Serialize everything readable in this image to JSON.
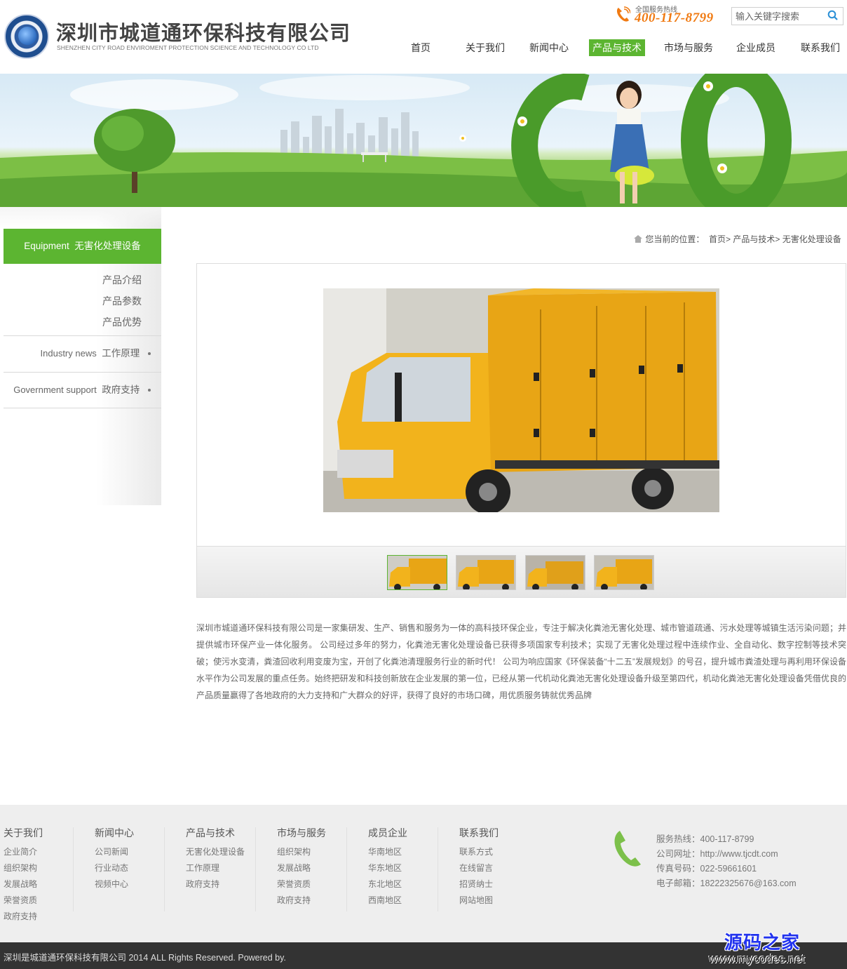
{
  "header": {
    "company_name": "深圳市城道通环保科技有限公司",
    "company_name_en": "SHENZHEN CITY ROAD ENVIROMENT PROTECTION SCIENCE AND TECHNOLOGY CO LTD",
    "hotline_label": "全国服务热线",
    "hotline_number": "400-117-8799",
    "search_placeholder": "输入关键字搜索",
    "accent_color": "#5cb531",
    "hotline_color": "#f07a12"
  },
  "nav": {
    "items": [
      {
        "label": "首页"
      },
      {
        "label": "关于我们"
      },
      {
        "label": "新闻中心"
      },
      {
        "label": "产品与技术",
        "active": true
      },
      {
        "label": "市场与服务"
      },
      {
        "label": "企业成员"
      },
      {
        "label": "联系我们"
      }
    ]
  },
  "sidebar": {
    "header_en": "Equipment",
    "header_cn": "无害化处理设备",
    "sub_items": [
      "产品介绍",
      "产品参数",
      "产品优势"
    ],
    "categories": [
      {
        "en": "Industry news",
        "cn": "工作原理"
      },
      {
        "en": "Government support",
        "cn": "政府支持"
      }
    ]
  },
  "breadcrumb": {
    "prefix": "您当前的位置：",
    "items": [
      "首页",
      "产品与技术",
      "无害化处理设备"
    ],
    "separator": ">"
  },
  "gallery": {
    "thumbnail_count": 4,
    "active_thumbnail": 1
  },
  "description": "深圳市城道通环保科技有限公司是一家集研发、生产、销售和服务为一体的高科技环保企业，专注于解决化粪池无害化处理、城市管道疏通、污水处理等城镇生活污染问题；并提供城市环保产业一体化服务。 公司经过多年的努力，化粪池无害化处理设备已获得多项国家专利技术；实现了无害化处理过程中连续作业、全自动化、数字控制等技术突破；使污水变清，粪渣回收利用变废为宝，开创了化粪池清理服务行业的新时代！ 公司为响应国家《环保装备“十二五”发展规划》的号召，提升城市粪渣处理与再利用环保设备水平作为公司发展的重点任务。始终把研发和科技创新放在企业发展的第一位，已经从第一代机动化粪池无害化处理设备升级至第四代，机动化粪池无害化处理设备凭借优良的产品质量赢得了各地政府的大力支持和广大群众的好评，获得了良好的市场口碑，用优质服务铸就优秀品牌",
  "footer": {
    "columns": [
      {
        "title": "关于我们",
        "links": [
          "企业简介",
          "组织架构",
          "发展战略",
          "荣誉资质",
          "政府支持"
        ]
      },
      {
        "title": "新闻中心",
        "links": [
          "公司新闻",
          "行业动态",
          "视频中心"
        ]
      },
      {
        "title": "产品与技术",
        "links": [
          "无害化处理设备",
          "工作原理",
          "政府支持"
        ]
      },
      {
        "title": "市场与服务",
        "links": [
          "组织架构",
          "发展战略",
          "荣誉资质",
          "政府支持"
        ]
      },
      {
        "title": "成员企业",
        "links": [
          "华南地区",
          "华东地区",
          "东北地区",
          "西南地区"
        ]
      },
      {
        "title": "联系我们",
        "links": [
          "联系方式",
          "在线留言",
          "招贤纳士",
          "网站地图"
        ]
      }
    ],
    "contact": [
      "服务热线：400-117-8799",
      "公司网址：http://www.tjcdt.com",
      "传真号码：022-59661601",
      "电子邮箱：18222325676@163.com"
    ],
    "copyright": "深圳是城道通环保科技有限公司 2014 ALL Rights Reserved. Powered by.",
    "watermark_cn": "源码之家",
    "watermark_url": "www.mycodes.net"
  }
}
